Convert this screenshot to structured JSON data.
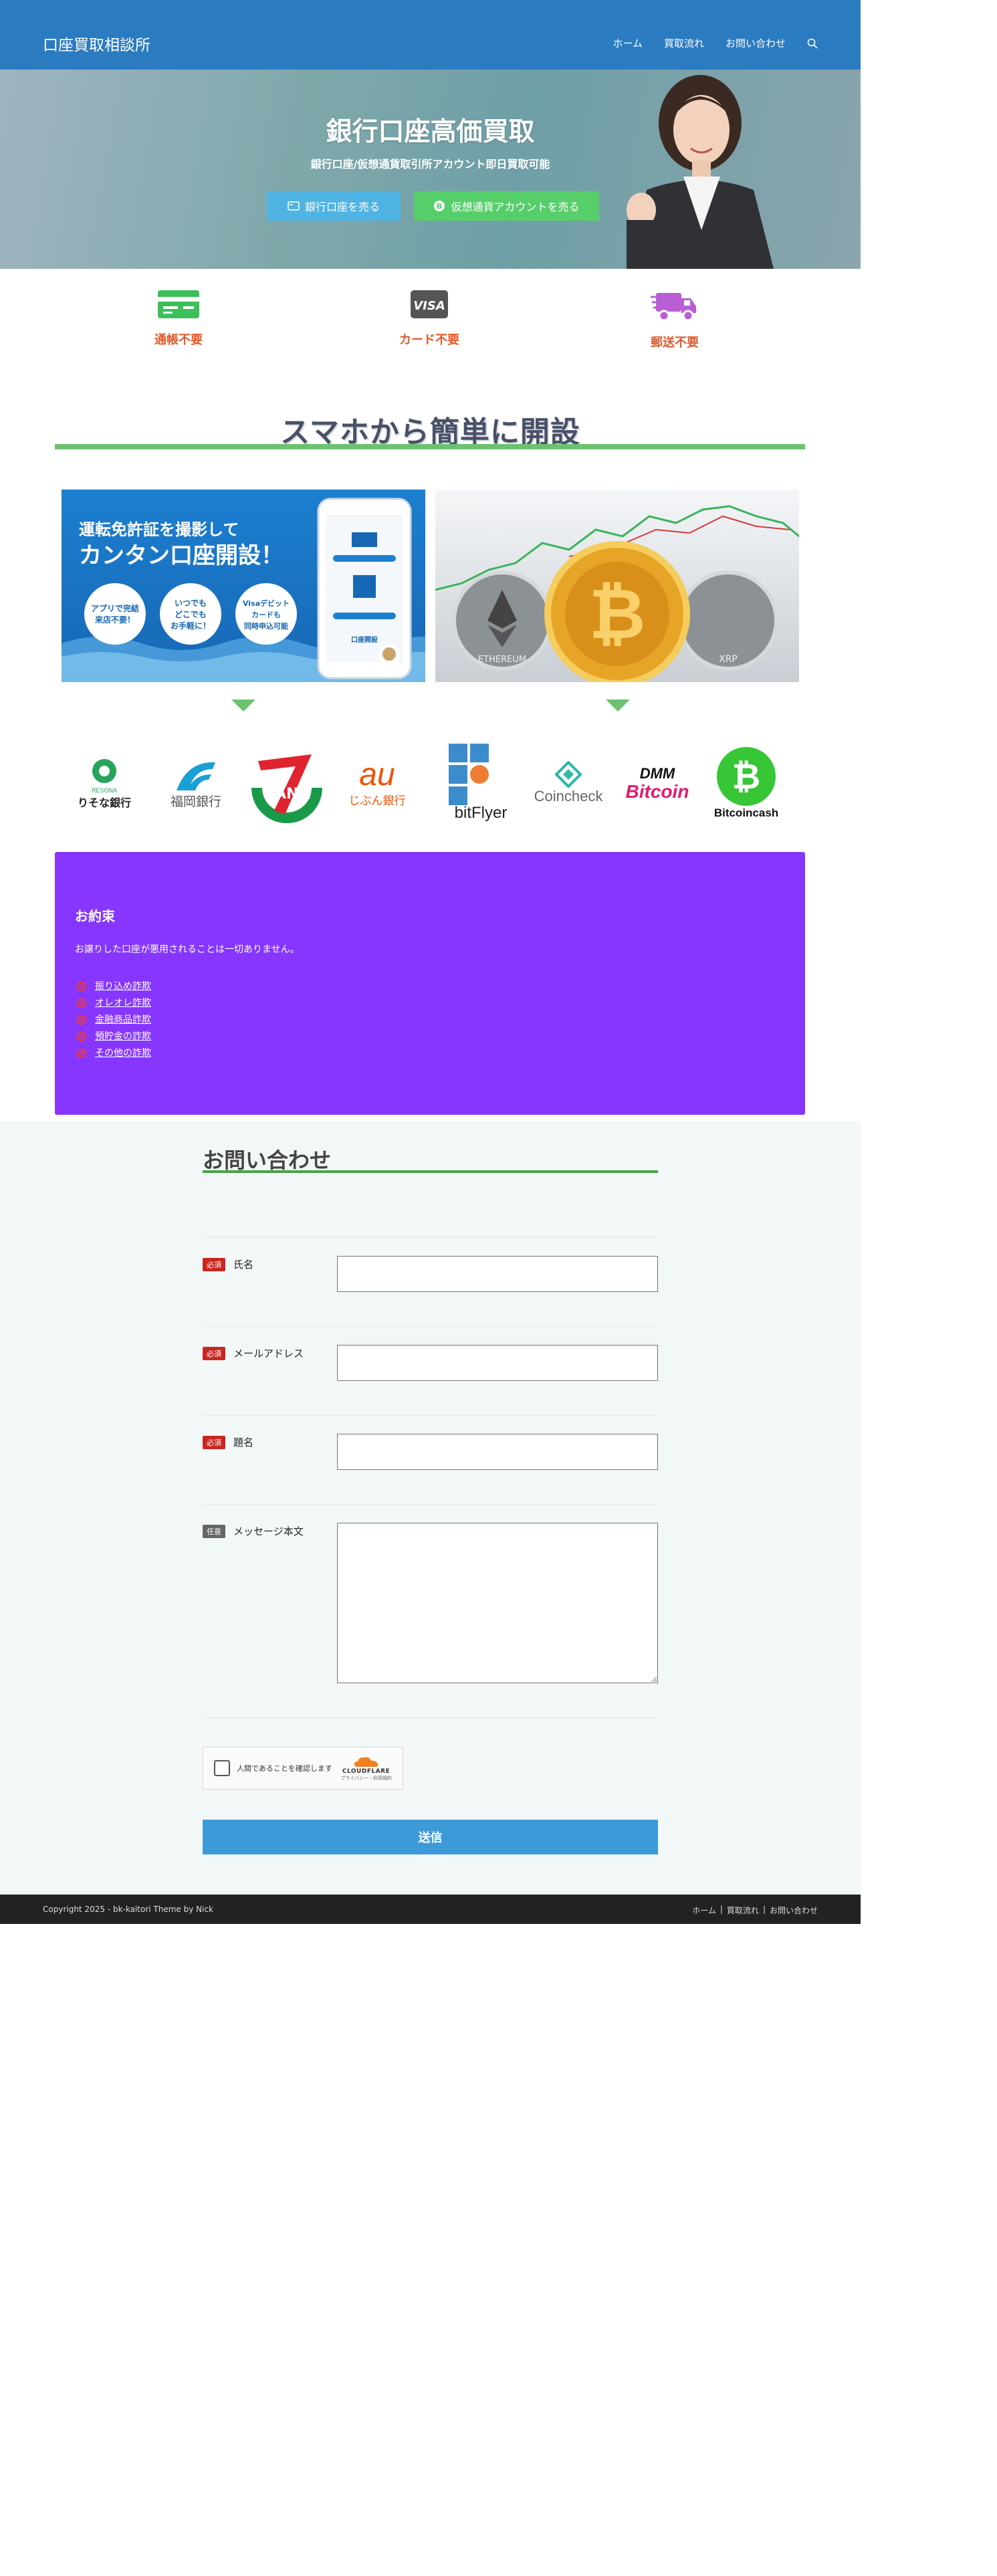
{
  "header": {
    "site_title": "口座買取相談所",
    "nav": [
      "ホーム",
      "買取流れ",
      "お問い合わせ"
    ],
    "search_icon": "search-icon"
  },
  "hero": {
    "title": "銀行口座高価買取",
    "subtitle": "銀行口座/仮想通貨取引所アカウント即日買取可能",
    "btn_bank": "銀行口座を売る",
    "btn_crypto": "仮想通貨アカウントを売る"
  },
  "features": [
    {
      "label": "通帳不要",
      "icon": "passbook-icon",
      "color": "#3cc05a"
    },
    {
      "label": "カード不要",
      "icon": "visa-card-icon",
      "color": "#555555"
    },
    {
      "label": "郵送不要",
      "icon": "delivery-truck-icon",
      "color": "#b95fd3"
    }
  ],
  "section": {
    "heading": "スマホから簡単に開設"
  },
  "banner_left": {
    "headline1": "運転免許証を撮影して",
    "headline2": "カンタン口座開設！",
    "bubbles": [
      [
        "アプリで完結",
        "来店不要！"
      ],
      [
        "いつでも",
        "どこでも",
        "お手軽に！"
      ],
      [
        "Visaデビット",
        "カードも",
        "同時申込可能"
      ]
    ],
    "phone_text": "口座開設"
  },
  "banner_right": {
    "coins": [
      "ETHEREUM",
      "XRP"
    ]
  },
  "logos": [
    {
      "name": "りそな銀行",
      "sub": "RESONA"
    },
    {
      "name": "福岡銀行"
    },
    {
      "name": "BANK"
    },
    {
      "name": "au",
      "sub": "じぶん銀行"
    },
    {
      "name": "bitFlyer"
    },
    {
      "name": "Coincheck"
    },
    {
      "name": "DMM",
      "sub": "Bitcoin"
    },
    {
      "name": "Bitcoincash"
    }
  ],
  "promise": {
    "title": "お約束",
    "text": "お譲りした口座が悪用されることは一切ありません。",
    "items": [
      "振り込め詐欺",
      "オレオレ詐欺",
      "金融商品詐欺",
      "預貯金の詐欺",
      "その他の詐欺"
    ]
  },
  "contact": {
    "title": "お問い合わせ",
    "required_tag": "必須",
    "optional_tag": "任意",
    "fields": [
      {
        "label": "氏名"
      },
      {
        "label": "メールアドレス"
      },
      {
        "label": "題名"
      },
      {
        "label": "メッセージ本文"
      }
    ],
    "captcha_text": "人間であることを確認します",
    "captcha_brand": "CLOUDFLARE",
    "captcha_links": "プライバシー・利用規約",
    "submit": "送信"
  },
  "footer": {
    "copyright": "Copyright 2025 - bk-kaitori Theme by Nick",
    "links": [
      "ホーム",
      "買取流れ",
      "お問い合わせ"
    ],
    "separator": "|"
  }
}
